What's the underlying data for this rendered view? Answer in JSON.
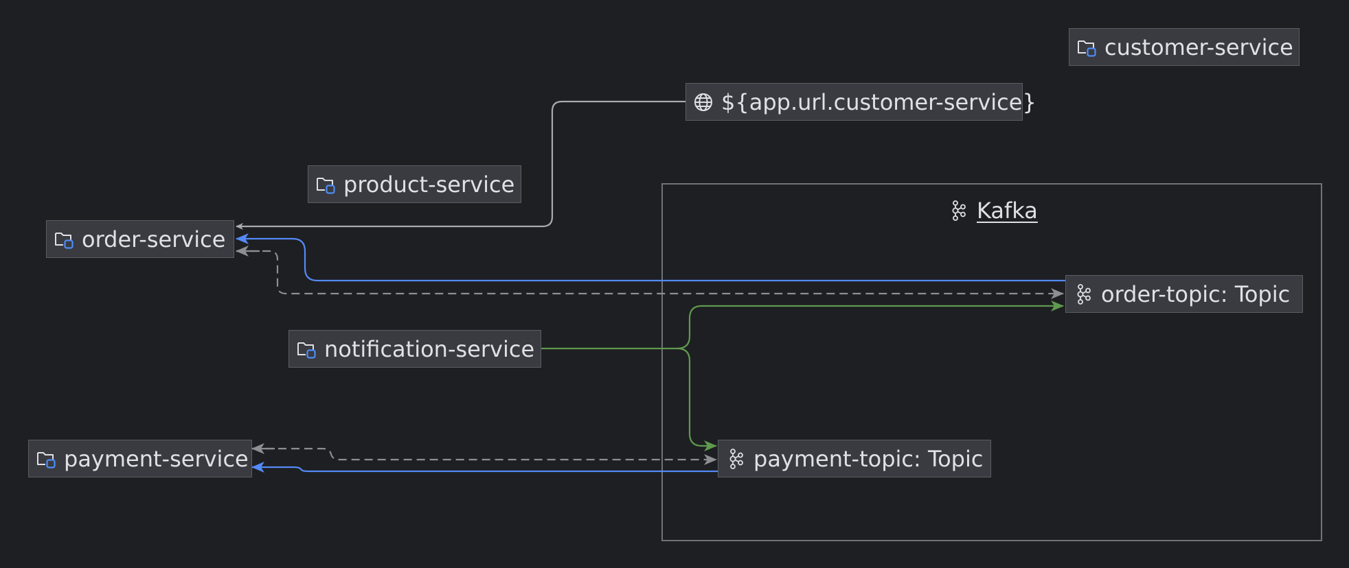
{
  "colors": {
    "background": "#1e1f22",
    "node_fill": "#393b40",
    "node_border": "#5a5d63",
    "text": "#dfe1e5",
    "service_icon_accent": "#4e8df7",
    "edge_http": "#a8abb0",
    "edge_consume": "#548af7",
    "edge_produce": "#5f9a4e",
    "edge_dashed": "#8c8f94"
  },
  "kafka": {
    "title": "Kafka",
    "icon": "kafka-icon"
  },
  "nodes": {
    "customer_service": {
      "label": "customer-service",
      "icon": "service-folder-icon"
    },
    "customer_service_url": {
      "label": "${app.url.customer-service}",
      "icon": "globe-icon"
    },
    "product_service": {
      "label": "product-service",
      "icon": "service-folder-icon"
    },
    "order_service": {
      "label": "order-service",
      "icon": "service-folder-icon"
    },
    "notification_service": {
      "label": "notification-service",
      "icon": "service-folder-icon"
    },
    "payment_service": {
      "label": "payment-service",
      "icon": "service-folder-icon"
    },
    "order_topic": {
      "label": "order-topic: Topic",
      "icon": "kafka-topic-icon"
    },
    "payment_topic": {
      "label": "payment-topic: Topic",
      "icon": "kafka-topic-icon"
    }
  }
}
